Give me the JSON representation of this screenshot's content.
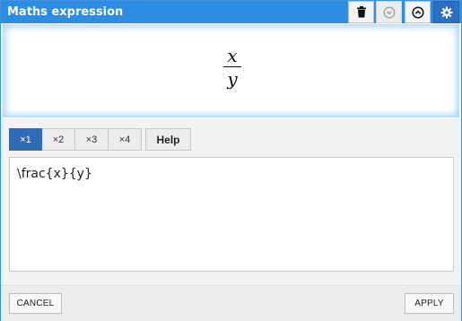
{
  "window": {
    "title": "Maths expression"
  },
  "toolbar": {
    "delete_icon": "trash-icon",
    "collapse_icon": "chevron-down-circle-icon",
    "expand_icon": "chevron-up-circle-icon",
    "settings_icon": "gear-icon"
  },
  "preview": {
    "numerator": "x",
    "denominator": "y"
  },
  "tabs": [
    {
      "label": "×1",
      "active": true
    },
    {
      "label": "×2",
      "active": false
    },
    {
      "label": "×3",
      "active": false
    },
    {
      "label": "×4",
      "active": false
    }
  ],
  "help_label": "Help",
  "editor": {
    "value": "\\frac{x}{y}"
  },
  "footer": {
    "cancel_label": "CANCEL",
    "apply_label": "APPLY"
  },
  "colors": {
    "titlebar": "#2d8de3",
    "active_tab": "#2f6bb6",
    "glow": "#a9d3f7"
  }
}
